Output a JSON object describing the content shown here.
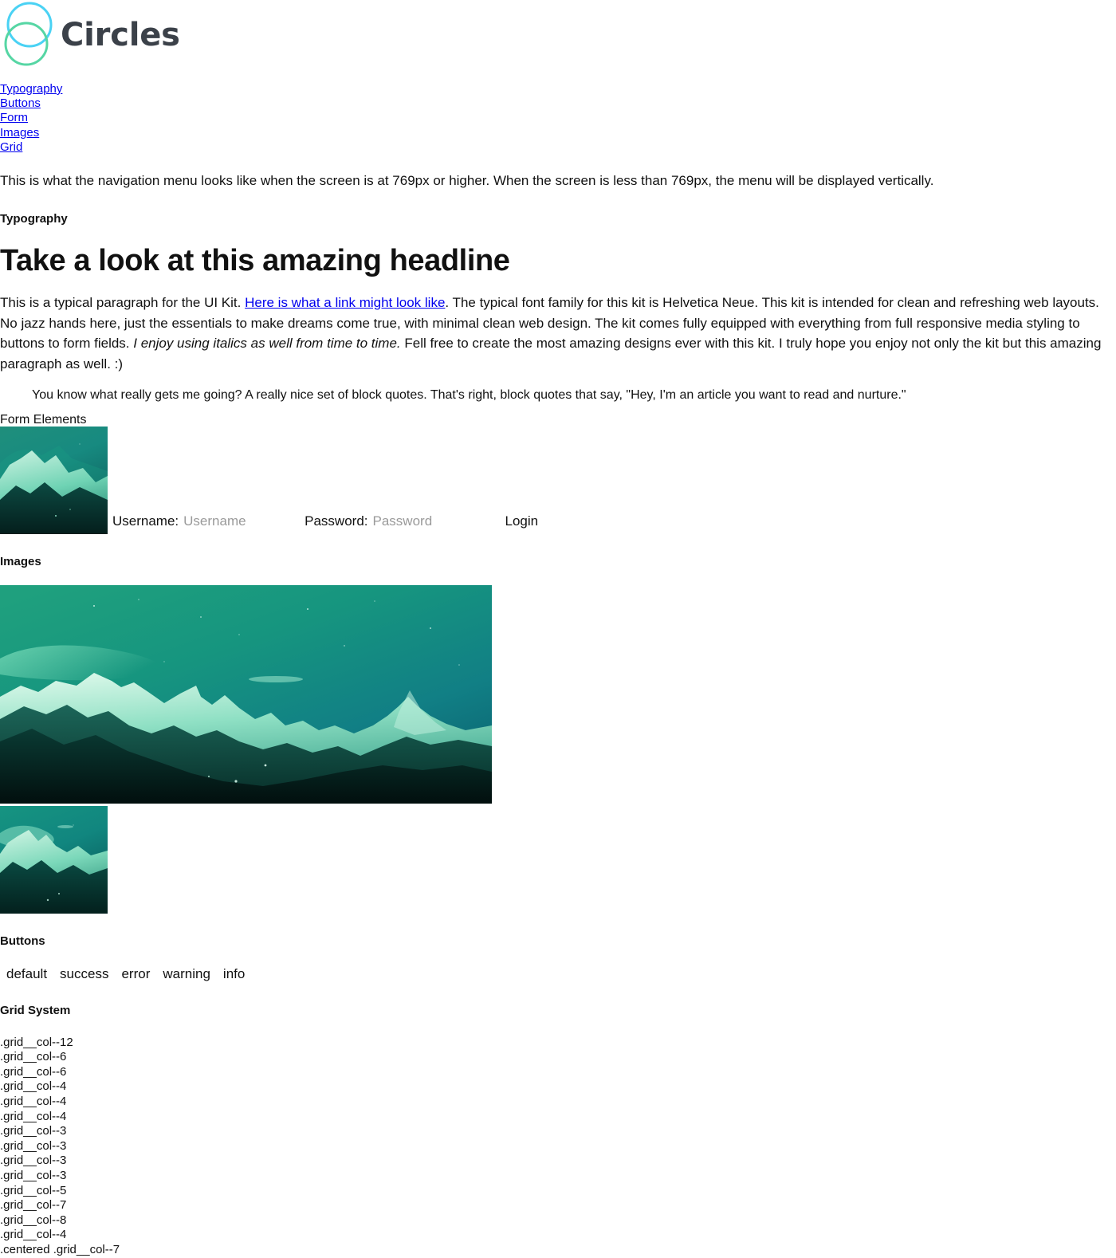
{
  "brand": {
    "name": "Circles",
    "logo_circle_top_color": "#4ad2f4",
    "logo_circle_bottom_color": "#56d6a4",
    "wordmark_color": "#3b4149"
  },
  "nav": {
    "items": [
      {
        "label": "Typography"
      },
      {
        "label": "Buttons"
      },
      {
        "label": "Form"
      },
      {
        "label": "Images"
      },
      {
        "label": "Grid"
      }
    ],
    "link_color": "#0000ee"
  },
  "intro": {
    "text": "This is what the navigation menu looks like when the screen is at 769px or higher. When the screen is less than 769px, the menu will be displayed vertically."
  },
  "typography": {
    "section_title": "Typography",
    "headline": "Take a look at this amazing headline",
    "paragraph_part1": "This is a typical paragraph for the UI Kit. ",
    "paragraph_link": "Here is what a link might look like",
    "paragraph_part2": ". The typical font family for this kit is Helvetica Neue. This kit is intended for clean and refreshing web layouts. No jazz hands here, just the essentials to make dreams come true, with minimal clean web design. The kit comes fully equipped with everything from full responsive media styling to buttons to form fields. ",
    "paragraph_italic": "I enjoy using italics as well from time to time.",
    "paragraph_part3": " Fell free to create the most amazing designs ever with this kit. I truly hope you enjoy not only the kit but this amazing paragraph as well. :)",
    "blockquote": "You know what really gets me going? A really nice set of block quotes. That's right, block quotes that say, \"Hey, I'm an article you want to read and nurture.\""
  },
  "form": {
    "section_title": "Form Elements",
    "username_label": "Username:",
    "username_placeholder": "Username",
    "username_value": "",
    "password_label": "Password:",
    "password_placeholder": "Password",
    "password_value": "",
    "login_label": "Login",
    "thumbnail_alt": "teal-mountain-landscape-thumbnail"
  },
  "images": {
    "section_title": "Images",
    "wide_alt": "teal-mountain-landscape-wide",
    "small_alt": "teal-mountain-landscape-small"
  },
  "buttons": {
    "section_title": "Buttons",
    "items": [
      {
        "label": "default"
      },
      {
        "label": "success"
      },
      {
        "label": "error"
      },
      {
        "label": "warning"
      },
      {
        "label": "info"
      }
    ]
  },
  "grid": {
    "section_title": "Grid System",
    "items": [
      {
        "label": ".grid__col--12"
      },
      {
        "label": ".grid__col--6"
      },
      {
        "label": ".grid__col--6"
      },
      {
        "label": ".grid__col--4"
      },
      {
        "label": ".grid__col--4"
      },
      {
        "label": ".grid__col--4"
      },
      {
        "label": ".grid__col--3"
      },
      {
        "label": ".grid__col--3"
      },
      {
        "label": ".grid__col--3"
      },
      {
        "label": ".grid__col--3"
      },
      {
        "label": ".grid__col--5"
      },
      {
        "label": ".grid__col--7"
      },
      {
        "label": ".grid__col--8"
      },
      {
        "label": ".grid__col--4"
      },
      {
        "label": ".centered .grid__col--7"
      }
    ]
  }
}
